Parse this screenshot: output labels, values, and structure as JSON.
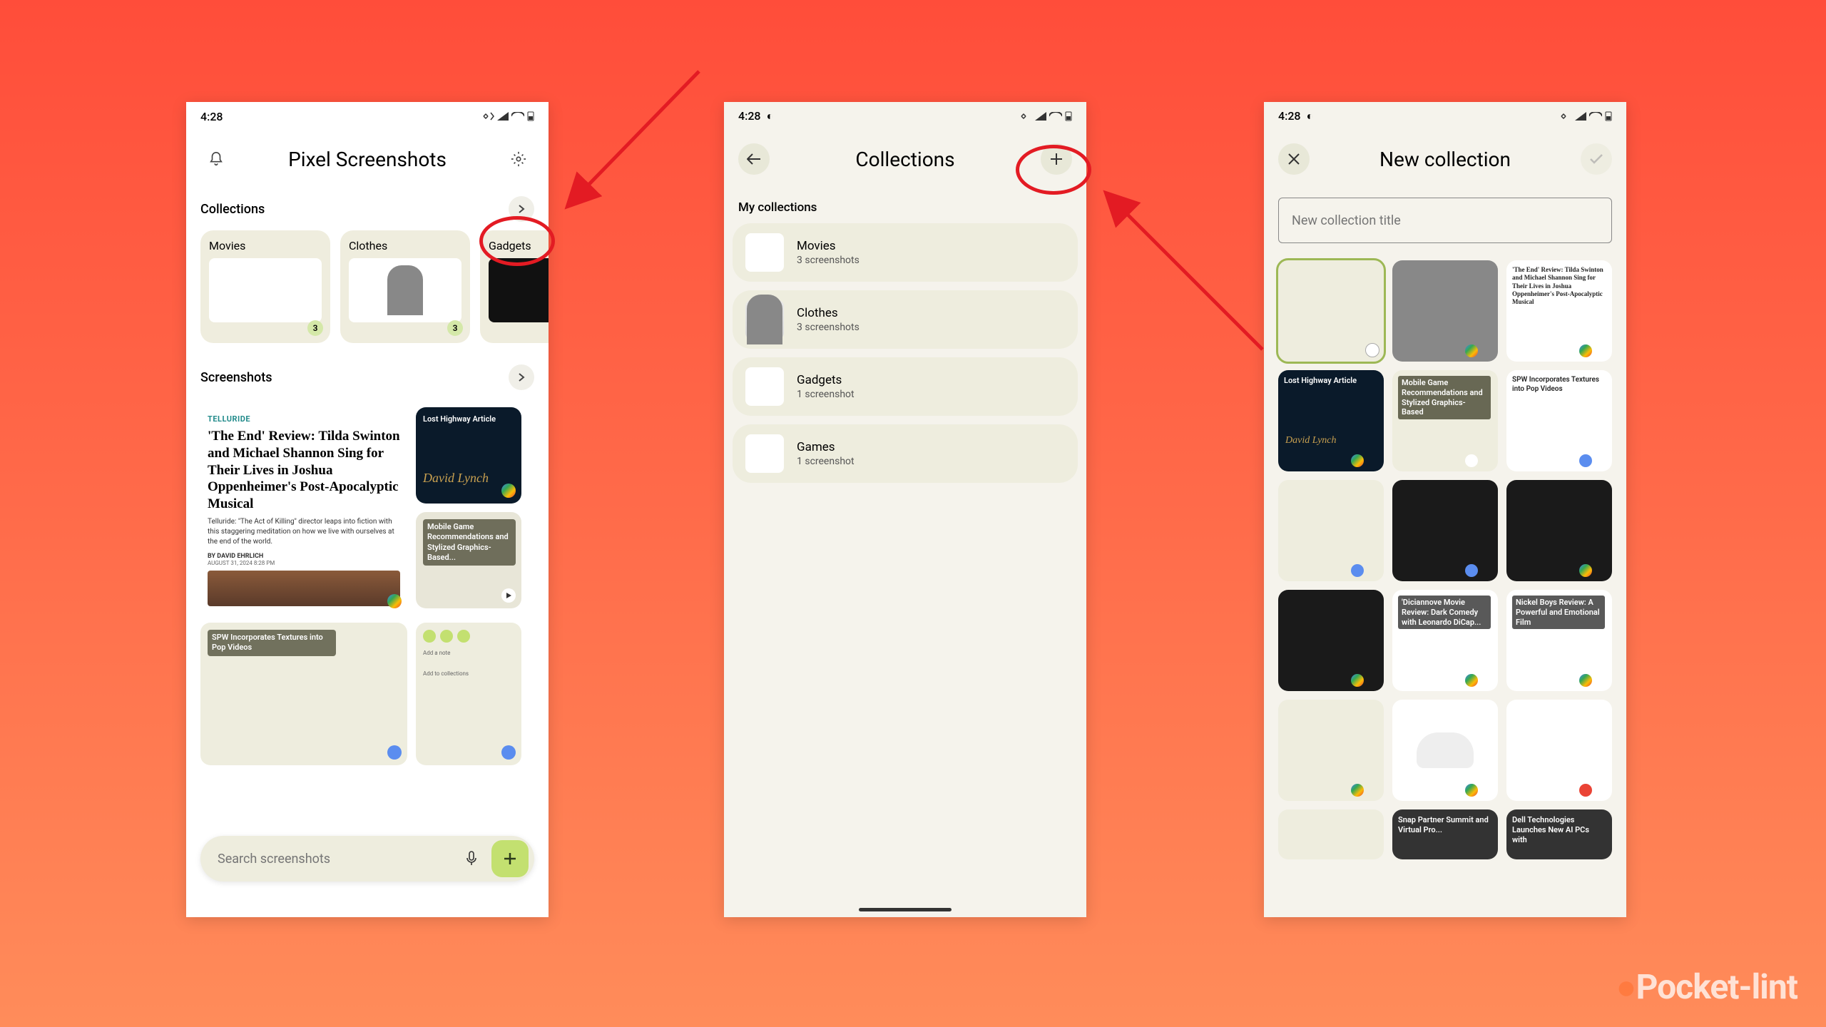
{
  "status": {
    "time": "4:28"
  },
  "phone1": {
    "title": "Pixel Screenshots",
    "collections_label": "Collections",
    "screenshots_label": "Screenshots",
    "collections": [
      {
        "name": "Movies",
        "count": "3"
      },
      {
        "name": "Clothes",
        "count": "3"
      },
      {
        "name": "Gadgets",
        "count": ""
      }
    ],
    "article": {
      "tag": "TELLURIDE",
      "title": "'The End' Review: Tilda Swinton and Michael Shannon Sing for Their Lives in Joshua Oppenheimer's Post-Apocalyptic Musical",
      "body": "Telluride: \"The Act of Killing\" director leaps into fiction with this staggering meditation on how we live with ourselves at the end of the world.",
      "byline": "BY DAVID EHRLICH",
      "date": "AUGUST 31, 2024 8:28 PM"
    },
    "shots": {
      "s1": "Lost Highway Article",
      "s2": "Mobile Game Recommendations and Stylized Graphics-Based...",
      "s3": "SPW Incorporates Textures into Pop Videos"
    },
    "search_placeholder": "Search screenshots"
  },
  "phone2": {
    "title": "Collections",
    "section": "My collections",
    "items": [
      {
        "name": "Movies",
        "sub": "3 screenshots"
      },
      {
        "name": "Clothes",
        "sub": "3 screenshots"
      },
      {
        "name": "Gadgets",
        "sub": "1 screenshot"
      },
      {
        "name": "Games",
        "sub": "1 screenshot"
      }
    ]
  },
  "phone3": {
    "title": "New collection",
    "placeholder": "New collection title",
    "tiles": {
      "t1": "",
      "t2": "'The End' Review: Tilda Swinton and Michael Shannon Sing for Their Lives in Joshua Oppenheimer's Post-Apocalyptic Musical",
      "t3": "Lost Highway Article",
      "t4": "Mobile Game Recommendations and Stylized Graphics-Based",
      "t5": "SPW Incorporates Textures into Pop Videos",
      "t6": "'Diciannove Movie Review: Dark Comedy with Leonardo DiCap...",
      "t7": "Nickel Boys Review: A Powerful and Emotional Film",
      "t8": "Snap Partner Summit and Virtual Pro...",
      "t9": "Dell Technologies Launches New AI PCs with"
    }
  },
  "watermark": "Pocket-lint"
}
